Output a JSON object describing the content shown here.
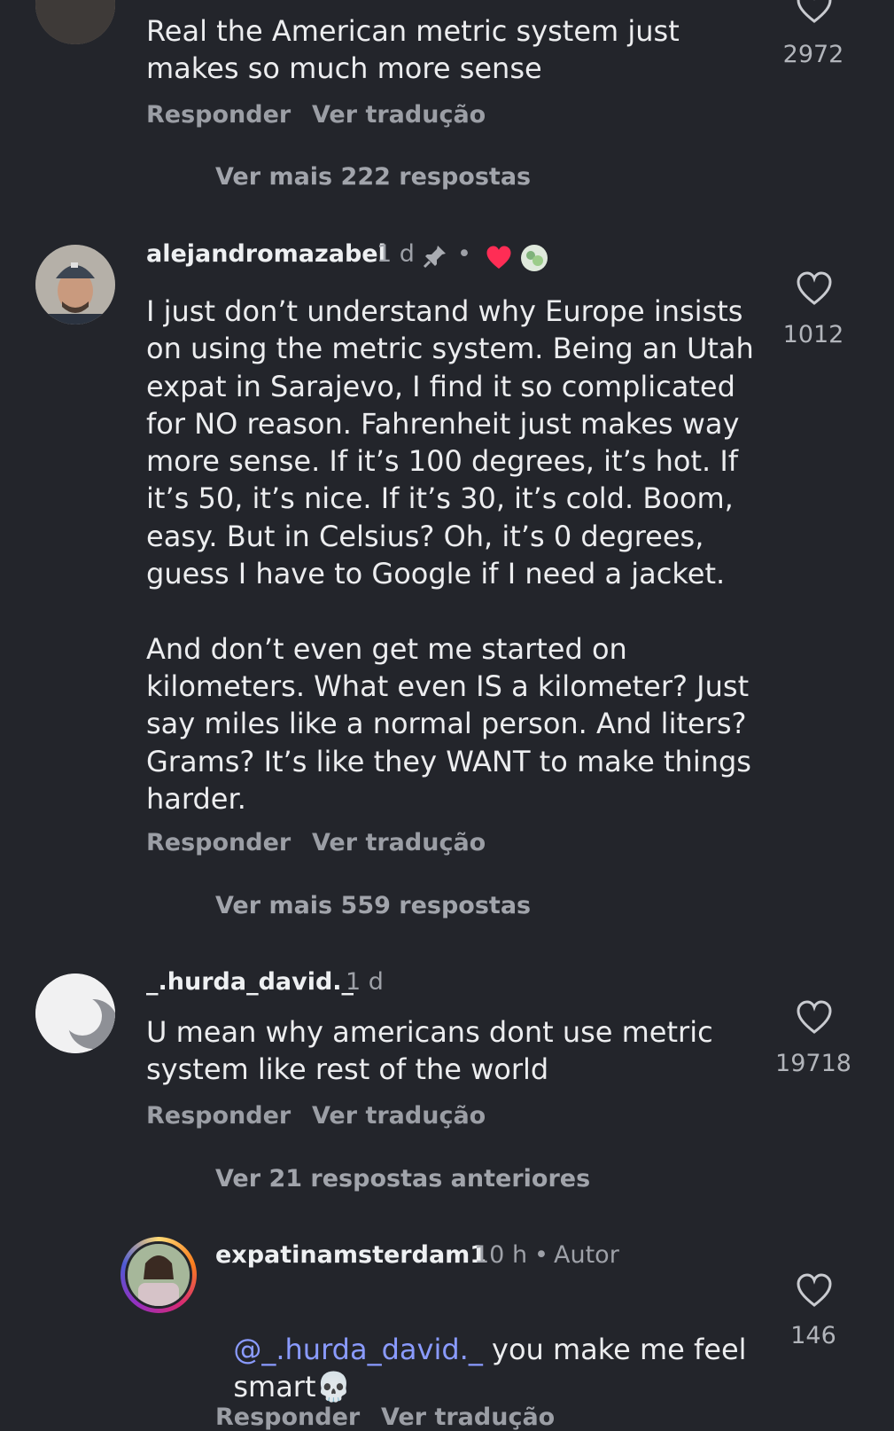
{
  "comments": [
    {
      "text": "Real the American metric system just\nmakes so much more sense",
      "likes": "2972",
      "reply": "Responder",
      "translate": "Ver tradução",
      "more_replies": "Ver mais 222 respostas"
    },
    {
      "username": "alejandromazabel",
      "time": "1 d",
      "separator": "•",
      "text": "I just don’t understand why Europe insists\non using the metric system. Being an Utah\nexpat in Sarajevo, I find it so complicated\nfor NO reason. Fahrenheit just makes way\nmore sense. If it’s 100 degrees, it’s hot. If\nit’s 50, it’s nice. If it’s 30, it’s cold. Boom,\neasy. But in Celsius? Oh, it’s 0 degrees,\nguess I have to Google if I need a jacket.\n\nAnd don’t even get me started on\nkilometers. What even IS a kilometer? Just\nsay miles like a normal person. And liters?\nGrams? It’s like they WANT to make things\nharder.",
      "likes": "1012",
      "reply": "Responder",
      "translate": "Ver tradução",
      "more_replies": "Ver mais 559 respostas"
    },
    {
      "username": "_.hurda_david._",
      "time": "1 d",
      "text": "U mean why americans dont use metric\nsystem like rest of the world",
      "likes": "19718",
      "reply": "Responder",
      "translate": "Ver tradução",
      "previous_replies": "Ver 21 respostas anteriores"
    },
    {
      "username": "expatinamsterdam1",
      "time": "10 h",
      "separator": "•",
      "author_tag": "Autor",
      "mention": "@_.hurda_david._",
      "text_line1": " you make me feel",
      "text_line2": "smart",
      "emoji": "💀",
      "likes": "146",
      "reply": "Responder",
      "translate": "Ver tradução"
    }
  ],
  "colors": {
    "background": "#23252b",
    "heart_red": "#ff2d55",
    "mention": "#8a9bff"
  },
  "icons": [
    "heart-outline-icon",
    "pin-icon",
    "heart-filled-icon",
    "skull-emoji"
  ]
}
